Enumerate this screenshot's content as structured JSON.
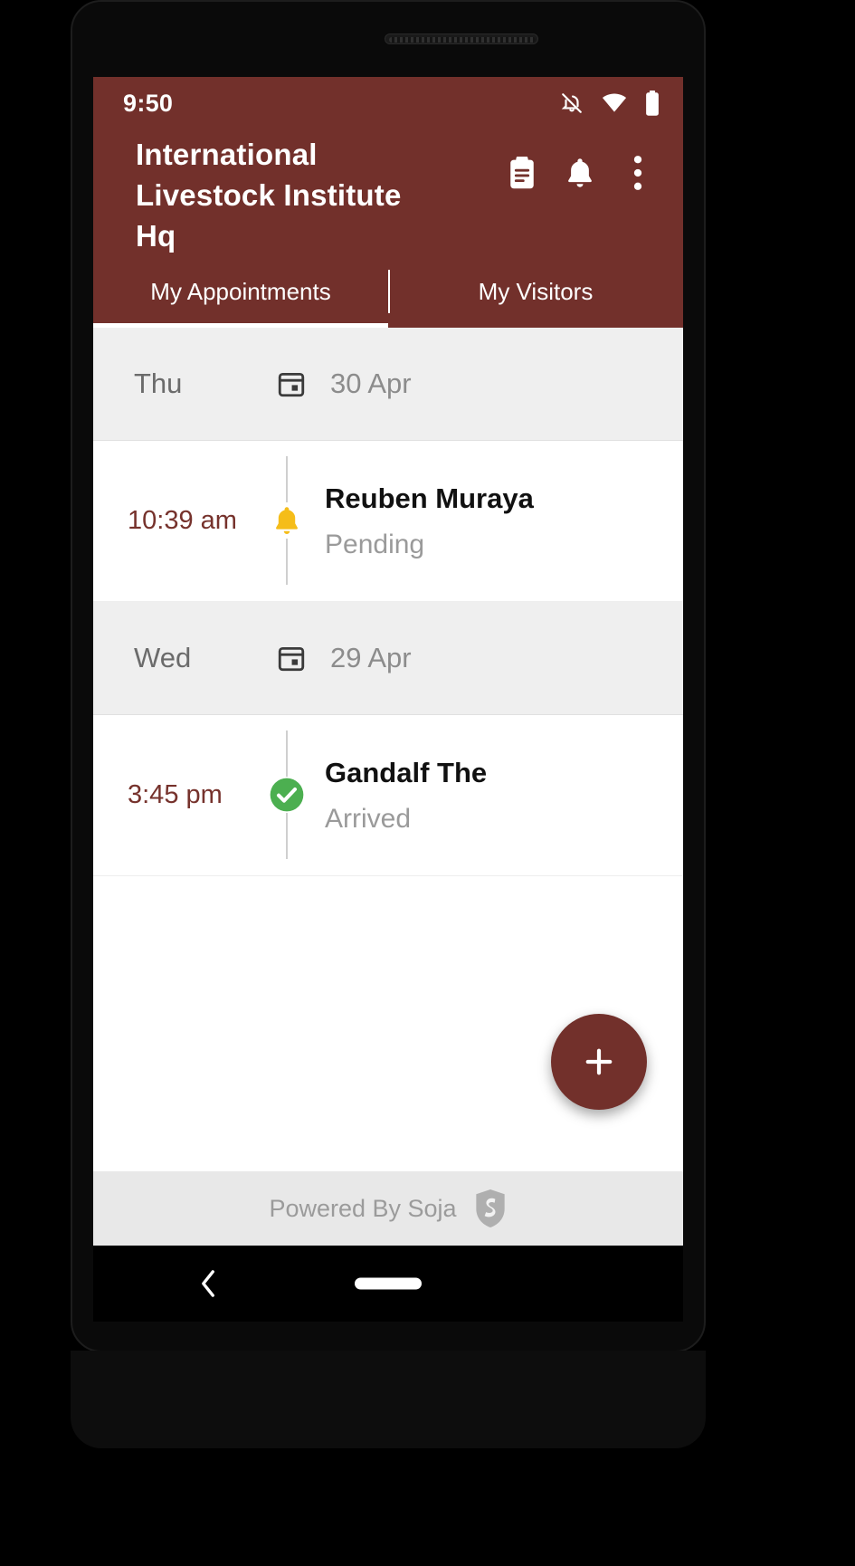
{
  "status_bar": {
    "time": "9:50",
    "icons": [
      "notifications-off-icon",
      "wifi-icon",
      "battery-full-icon"
    ]
  },
  "header": {
    "title": "International Livestock Institute Hq",
    "actions": [
      {
        "name": "clipboard-icon",
        "label": "Clipboard"
      },
      {
        "name": "bell-icon",
        "label": "Notifications"
      },
      {
        "name": "overflow-menu-icon",
        "label": "More options"
      }
    ],
    "background_color": "#72302B",
    "text_color": "#FFFFFF"
  },
  "tabs": [
    {
      "label": "My Appointments",
      "active": true
    },
    {
      "label": "My Visitors",
      "active": false
    }
  ],
  "groups": [
    {
      "day": "Thu",
      "date": "30 Apr",
      "calendar_icon": "calendar-icon",
      "appointments": [
        {
          "time": "10:39 am",
          "name": "Reuben Muraya",
          "status": "Pending",
          "status_icon": "bell-icon",
          "status_color": "#F5BD19"
        }
      ]
    },
    {
      "day": "Wed",
      "date": "29 Apr",
      "calendar_icon": "calendar-icon",
      "appointments": [
        {
          "time": "3:45 pm",
          "name": "Gandalf The",
          "status": "Arrived",
          "status_icon": "check-circle-icon",
          "status_color": "#4CAF50"
        }
      ]
    }
  ],
  "fab": {
    "icon": "plus-icon",
    "label": "Add appointment",
    "color": "#72302B"
  },
  "footer": {
    "text": "Powered By Soja",
    "logo": "soja-shield-logo"
  },
  "navigation_bar": {
    "back": "back-chevron-icon",
    "home": "home-pill-indicator"
  },
  "colors": {
    "primary": "#72302B",
    "time_text": "#76322C",
    "date_header_bg": "#EFEFEF",
    "muted_text": "#9A9A9A",
    "footer_bg": "#E8E8E8"
  }
}
